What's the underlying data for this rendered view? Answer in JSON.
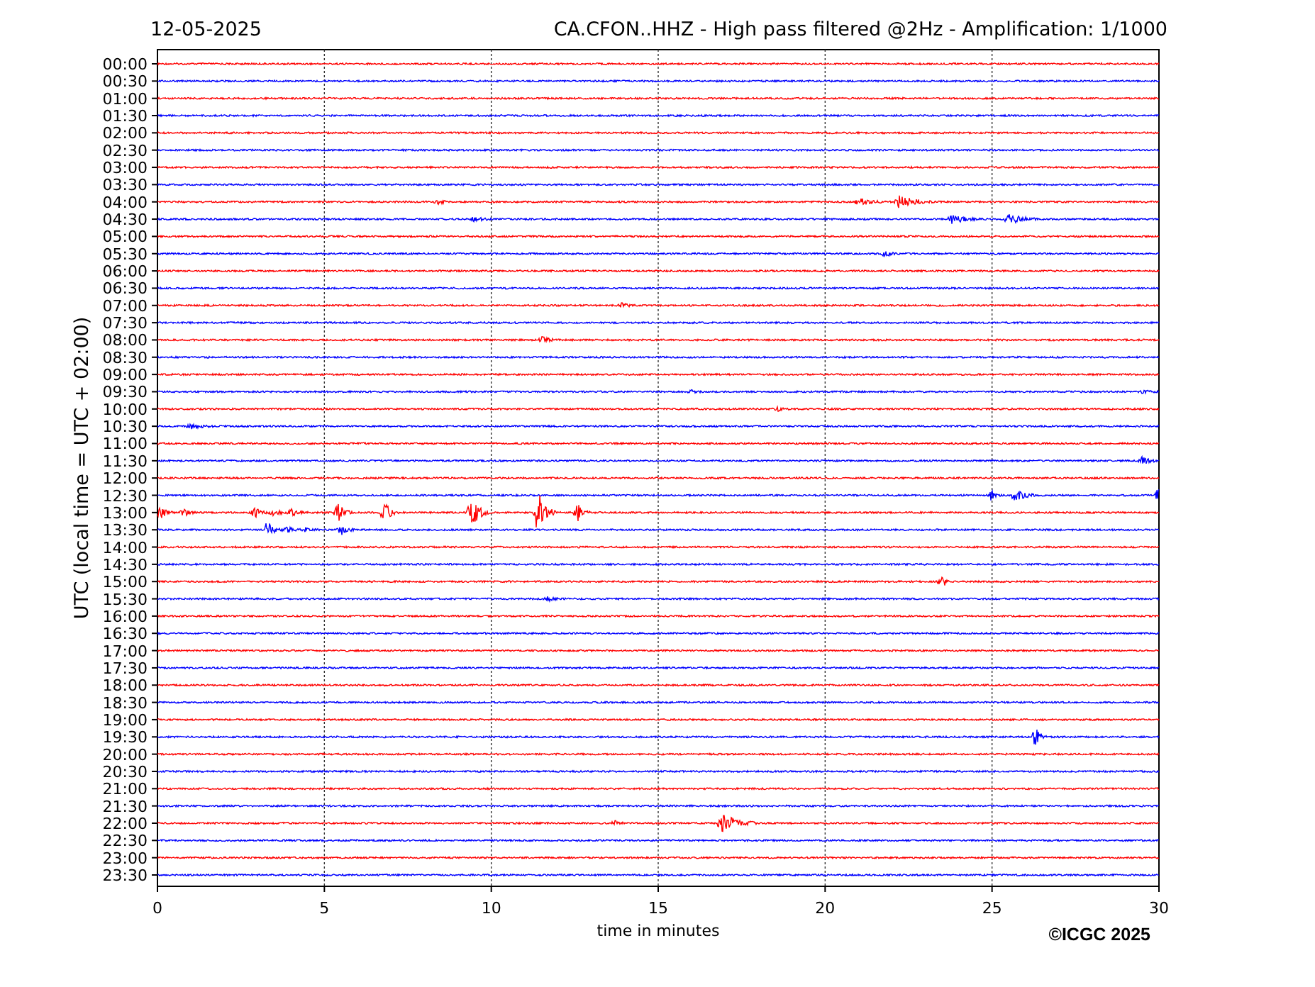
{
  "date": "12-05-2025",
  "title": "CA.CFON..HHZ - High pass filtered @2Hz - Amplification: 1/1000",
  "ylabel": "UTC (local time = UTC + 02:00)",
  "xlabel": "time in minutes",
  "xticks": [
    "0",
    "5",
    "10",
    "15",
    "20",
    "25",
    "30"
  ],
  "copyright": "©ICGC 2025",
  "rows": [
    {
      "label": "00:00",
      "color": "#ff0000"
    },
    {
      "label": "00:30",
      "color": "#0000ff"
    },
    {
      "label": "01:00",
      "color": "#ff0000"
    },
    {
      "label": "01:30",
      "color": "#0000ff"
    },
    {
      "label": "02:00",
      "color": "#ff0000"
    },
    {
      "label": "02:30",
      "color": "#0000ff"
    },
    {
      "label": "03:00",
      "color": "#ff0000"
    },
    {
      "label": "03:30",
      "color": "#0000ff"
    },
    {
      "label": "04:00",
      "color": "#ff0000"
    },
    {
      "label": "04:30",
      "color": "#0000ff"
    },
    {
      "label": "05:00",
      "color": "#ff0000"
    },
    {
      "label": "05:30",
      "color": "#0000ff"
    },
    {
      "label": "06:00",
      "color": "#ff0000"
    },
    {
      "label": "06:30",
      "color": "#0000ff"
    },
    {
      "label": "07:00",
      "color": "#ff0000"
    },
    {
      "label": "07:30",
      "color": "#0000ff"
    },
    {
      "label": "08:00",
      "color": "#ff0000"
    },
    {
      "label": "08:30",
      "color": "#0000ff"
    },
    {
      "label": "09:00",
      "color": "#ff0000"
    },
    {
      "label": "09:30",
      "color": "#0000ff"
    },
    {
      "label": "10:00",
      "color": "#ff0000"
    },
    {
      "label": "10:30",
      "color": "#0000ff"
    },
    {
      "label": "11:00",
      "color": "#ff0000"
    },
    {
      "label": "11:30",
      "color": "#0000ff"
    },
    {
      "label": "12:00",
      "color": "#ff0000"
    },
    {
      "label": "12:30",
      "color": "#0000ff"
    },
    {
      "label": "13:00",
      "color": "#ff0000"
    },
    {
      "label": "13:30",
      "color": "#0000ff"
    },
    {
      "label": "14:00",
      "color": "#ff0000"
    },
    {
      "label": "14:30",
      "color": "#0000ff"
    },
    {
      "label": "15:00",
      "color": "#ff0000"
    },
    {
      "label": "15:30",
      "color": "#0000ff"
    },
    {
      "label": "16:00",
      "color": "#ff0000"
    },
    {
      "label": "16:30",
      "color": "#0000ff"
    },
    {
      "label": "17:00",
      "color": "#ff0000"
    },
    {
      "label": "17:30",
      "color": "#0000ff"
    },
    {
      "label": "18:00",
      "color": "#ff0000"
    },
    {
      "label": "18:30",
      "color": "#0000ff"
    },
    {
      "label": "19:00",
      "color": "#ff0000"
    },
    {
      "label": "19:30",
      "color": "#0000ff"
    },
    {
      "label": "20:00",
      "color": "#ff0000"
    },
    {
      "label": "20:30",
      "color": "#0000ff"
    },
    {
      "label": "21:00",
      "color": "#ff0000"
    },
    {
      "label": "21:30",
      "color": "#0000ff"
    },
    {
      "label": "22:00",
      "color": "#ff0000"
    },
    {
      "label": "22:30",
      "color": "#0000ff"
    },
    {
      "label": "23:00",
      "color": "#ff0000"
    },
    {
      "label": "23:30",
      "color": "#0000ff"
    }
  ]
}
